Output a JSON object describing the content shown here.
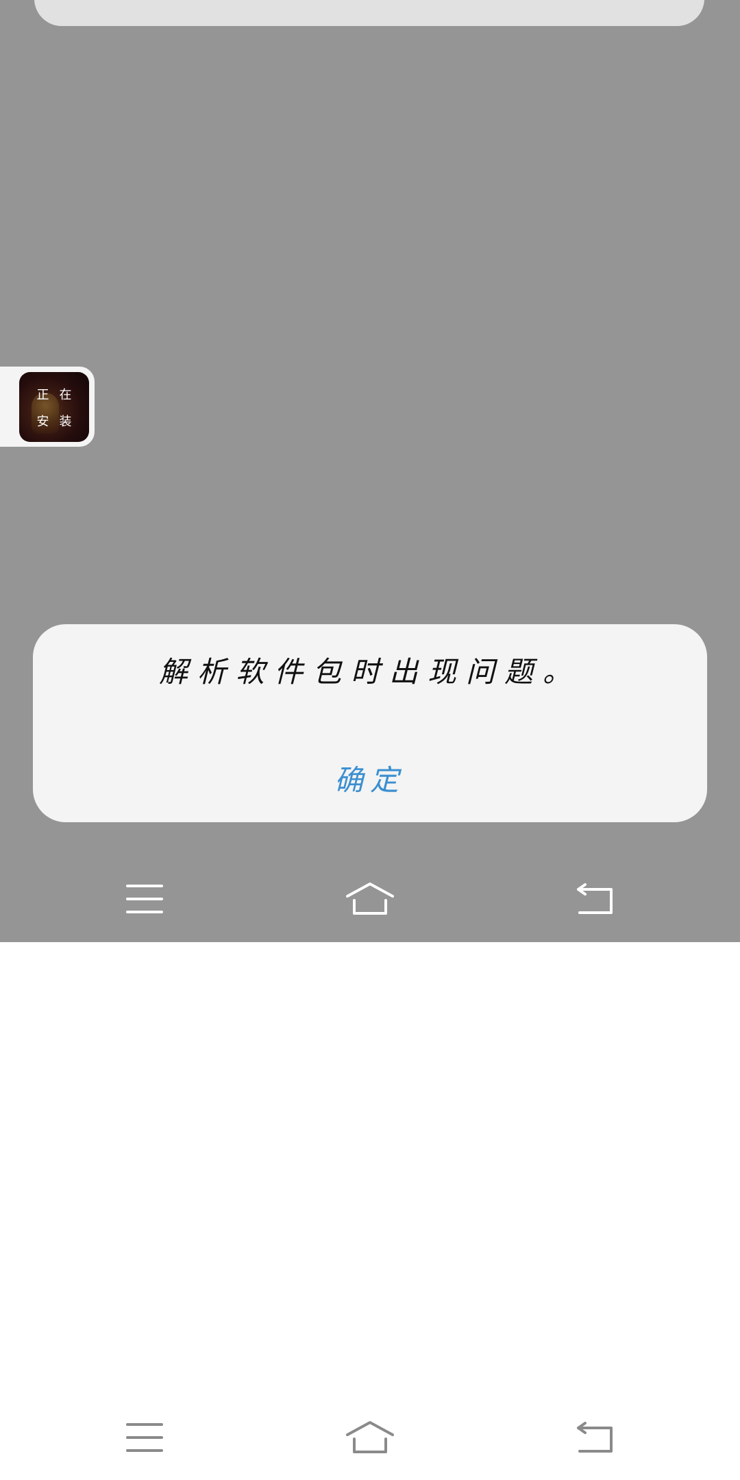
{
  "dialog": {
    "message": "解析软件包时出现问题。",
    "ok_label": "确定"
  },
  "install_badge": {
    "line1_left": "正",
    "line1_right": "在",
    "line2_left": "安",
    "line2_right": "装"
  },
  "navigation": {
    "upper_icons": [
      "menu-icon",
      "home-icon",
      "back-icon"
    ],
    "lower_icons": [
      "menu-icon",
      "home-icon",
      "back-icon"
    ]
  },
  "colors": {
    "overlay": "#959595",
    "dialog_background": "#f4f4f4",
    "accent": "#3b8fd0",
    "upper_nav_icon": "#ffffff",
    "lower_nav_icon": "#8a8a8a"
  }
}
